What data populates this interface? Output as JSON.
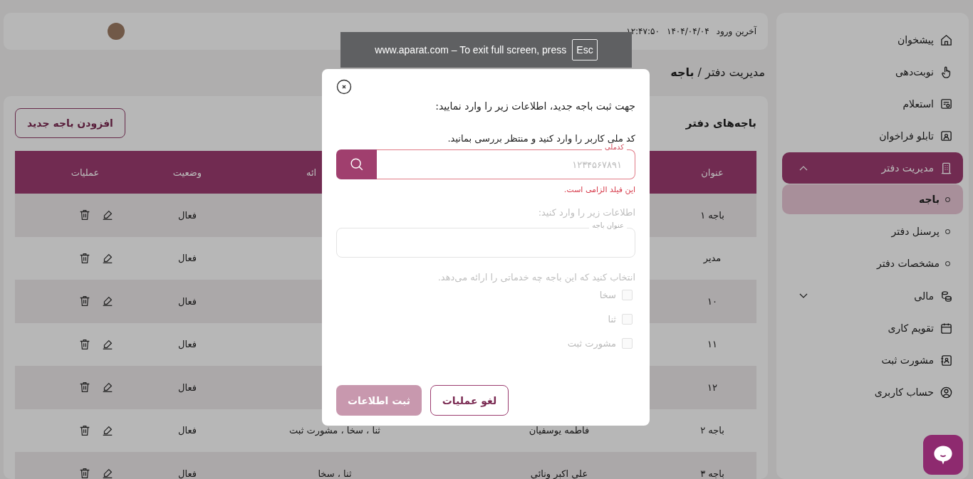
{
  "fullscreen_notice": {
    "text": "www.aparat.com – To exit full screen, press",
    "key": "Esc"
  },
  "sidebar": {
    "items": [
      {
        "label": "پیشخوان",
        "kind": "home",
        "selected": false
      },
      {
        "label": "نوبت‌دهی",
        "kind": "hand",
        "selected": false
      },
      {
        "label": "استعلام",
        "kind": "inquiry",
        "selected": false
      },
      {
        "label": "تابلو فراخوان",
        "kind": "board",
        "selected": false
      },
      {
        "label": "مدیریت دفتر",
        "kind": "building",
        "selected": true,
        "expanded": true,
        "children": [
          {
            "label": "باجه",
            "selected": true
          },
          {
            "label": "پرسنل دفتر",
            "selected": false
          },
          {
            "label": "مشخصات دفتر",
            "selected": false
          }
        ]
      },
      {
        "label": "مالی",
        "kind": "coins",
        "selected": false,
        "expanded": false
      },
      {
        "label": "تقویم کاری",
        "kind": "calendar",
        "selected": false
      },
      {
        "label": "مشورت ثبت",
        "kind": "contact",
        "selected": false
      },
      {
        "label": "حساب کاربری",
        "kind": "user",
        "selected": false
      }
    ]
  },
  "header": {
    "last_login_label": "آخرین ورود",
    "last_login_date": "۱۴۰۴/۰۴/۰۴",
    "last_login_time": "۱۲:۴۷:۵۰"
  },
  "breadcrumb": "مدیریت دفتر / **باجه**",
  "card": {
    "title": "باجه‌های دفتر",
    "add_button": "افزودن باجه جدید"
  },
  "table": {
    "columns": [
      "عنوان",
      "",
      "ائه",
      "وضعیت",
      "عملیات"
    ],
    "rows": [
      {
        "title": "باجه ۱",
        "status": "فعال"
      },
      {
        "title": "مدیر",
        "status": "فعال"
      },
      {
        "title": "۱۰",
        "status": "فعال"
      },
      {
        "title": "۱۱",
        "status": "فعال"
      },
      {
        "title": "۱۲",
        "status": "فعال"
      },
      {
        "title": "باجه ۲",
        "name": "فاطمه یوسفیان",
        "services": "ثنا ، سخا ، مشورت ثبت",
        "status": "فعال"
      },
      {
        "title": "باجه ۳",
        "name": "علی اکبر ونائی",
        "services": "ثنا ، سخا",
        "status": "فعال"
      }
    ]
  },
  "modal": {
    "title": "جهت ثبت باجه جدید، اطلاعات زیر را وارد نمایید:",
    "instruction": "کد ملی کاربر را وارد کنید و منتظر بررسی بمانید.",
    "national_id": {
      "label": "کدملی",
      "placeholder": "۱۲۳۴۵۶۷۸۹۱",
      "error": "این فیلد الزامی است."
    },
    "details_prompt": "اطلاعات زیر را وارد کنید:",
    "counter_title": {
      "label": "عنوان باجه",
      "disabled": true
    },
    "services_prompt": "انتخاب کنید که این باجه چه خدماتی را ارائه می‌دهد.",
    "services": [
      {
        "label": "سخا",
        "checked": false,
        "disabled": true
      },
      {
        "label": "ثنا",
        "checked": false,
        "disabled": true
      },
      {
        "label": "مشورت ثبت",
        "checked": false,
        "disabled": true
      }
    ],
    "submit": {
      "label": "ثبت اطلاعات",
      "disabled": true
    },
    "cancel": {
      "label": "لغو عملیات"
    }
  }
}
